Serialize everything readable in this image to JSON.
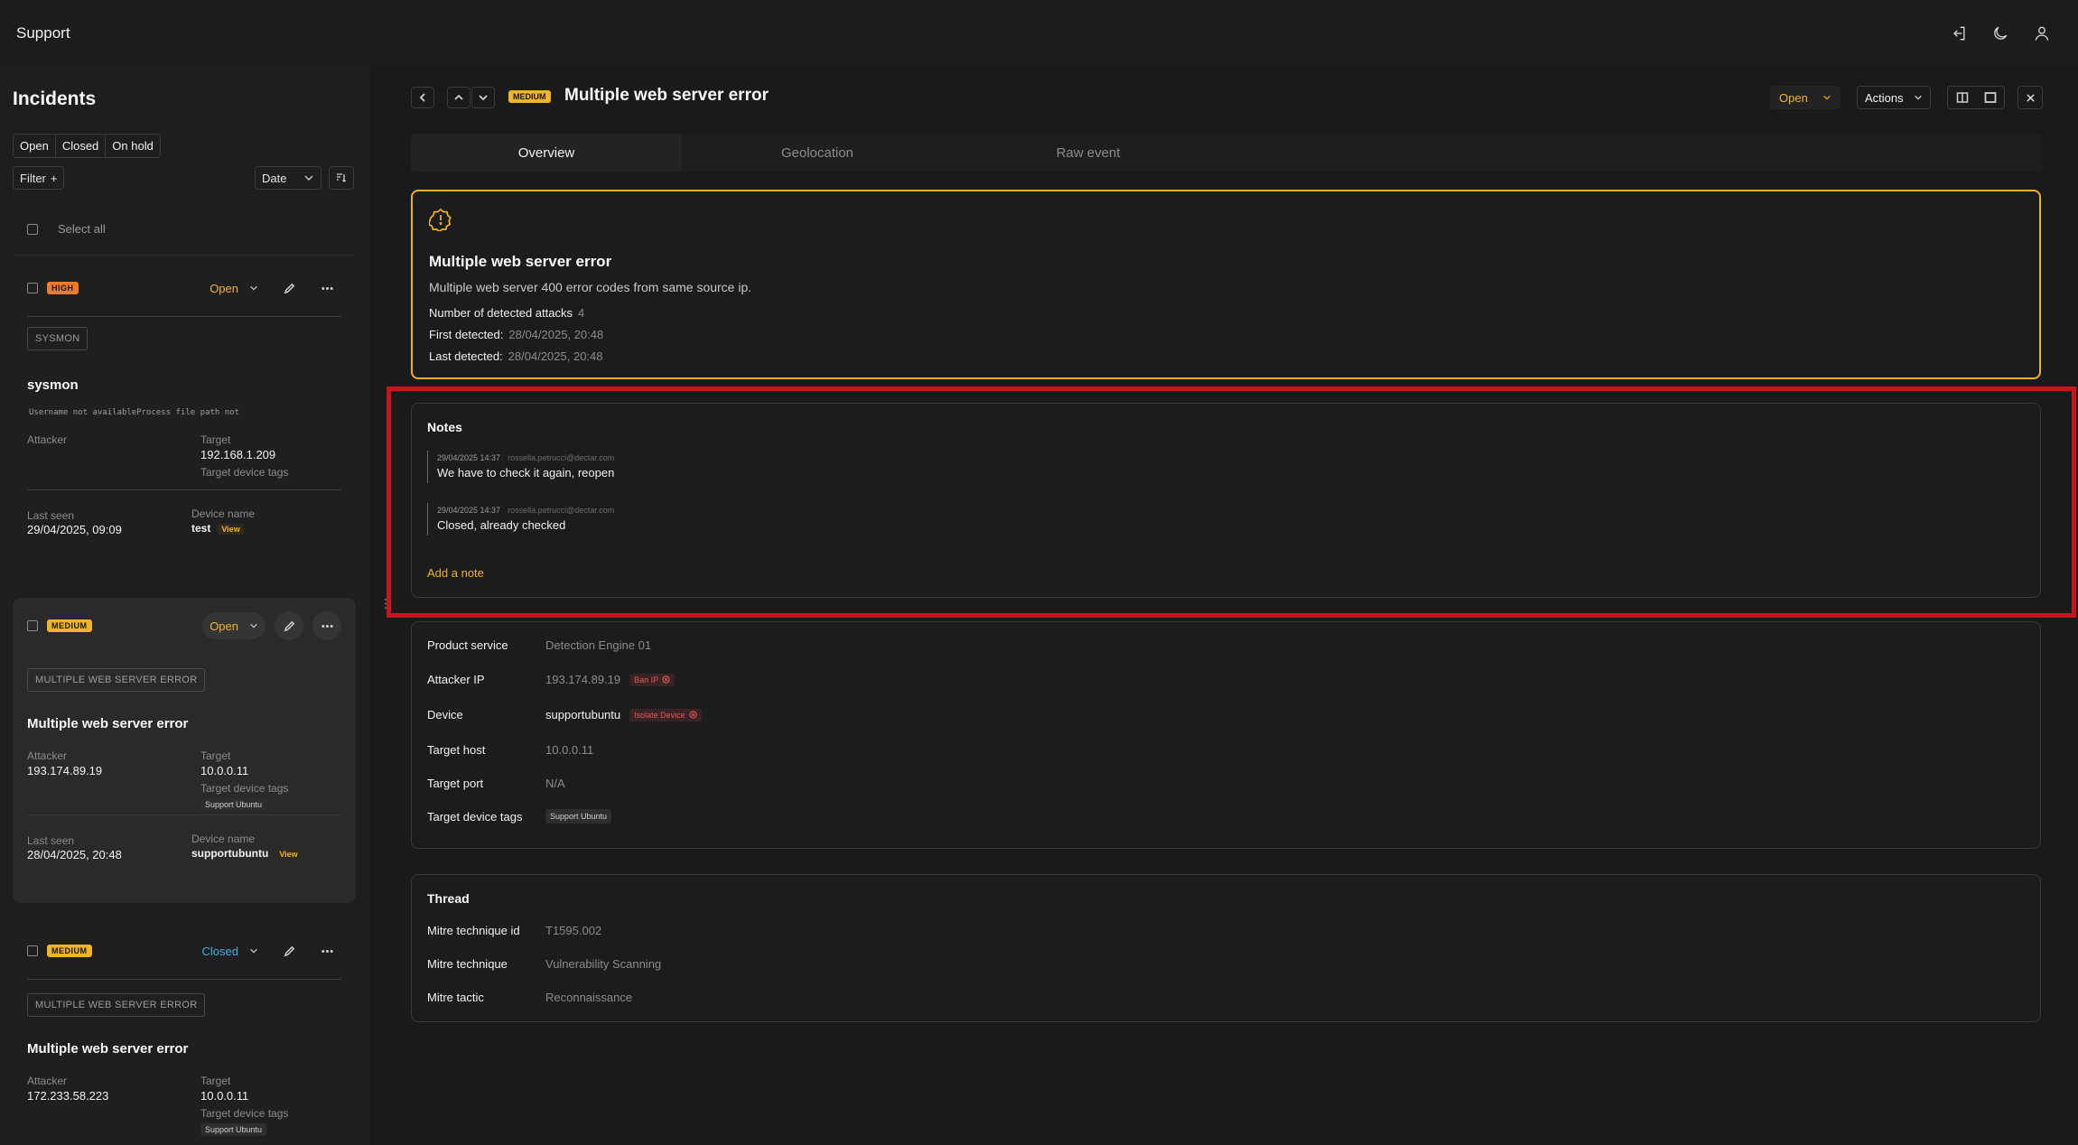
{
  "app": {
    "title": "Support"
  },
  "sidebar": {
    "title": "Incidents",
    "status_tabs": [
      "Open",
      "Closed",
      "On hold"
    ],
    "filter_label": "Filter",
    "sort_label": "Date",
    "select_all": "Select all",
    "cards": [
      {
        "severity": "HIGH",
        "status": "Open",
        "tag": "SYSMON",
        "title": "sysmon",
        "description": "Username not availableProcess file path not",
        "attacker_label": "Attacker",
        "attacker": "",
        "target_label": "Target",
        "target": "192.168.1.209",
        "tags_label": "Target device tags",
        "tags": "",
        "last_seen_label": "Last seen",
        "last_seen": "29/04/2025, 09:09",
        "device_label": "Device name",
        "device": "test",
        "view": "View"
      },
      {
        "severity": "MEDIUM",
        "status": "Open",
        "tag": "MULTIPLE WEB SERVER ERROR",
        "title": "Multiple web server error",
        "attacker_label": "Attacker",
        "attacker": "193.174.89.19",
        "target_label": "Target",
        "target": "10.0.0.11",
        "tags_label": "Target device tags",
        "tags": "Support Ubuntu",
        "last_seen_label": "Last seen",
        "last_seen": "28/04/2025, 20:48",
        "device_label": "Device name",
        "device": "supportubuntu",
        "view": "View"
      },
      {
        "severity": "MEDIUM",
        "status": "Closed",
        "tag": "MULTIPLE WEB SERVER ERROR",
        "title": "Multiple web server error",
        "attacker_label": "Attacker",
        "attacker": "172.233.58.223",
        "target_label": "Target",
        "target": "10.0.0.11",
        "tags_label": "Target device tags",
        "tags": "Support Ubuntu"
      }
    ]
  },
  "detail": {
    "severity": "MEDIUM",
    "title": "Multiple web server error",
    "status": "Open",
    "actions_label": "Actions",
    "tabs": [
      "Overview",
      "Geolocation",
      "Raw event"
    ],
    "alert": {
      "title": "Multiple web server error",
      "description": "Multiple web server 400 error codes from same source ip.",
      "attacks_label": "Number of detected attacks",
      "attacks": "4",
      "first_label": "First detected:",
      "first": "28/04/2025, 20:48",
      "last_label": "Last detected:",
      "last": "28/04/2025, 20:48"
    },
    "notes": {
      "title": "Notes",
      "items": [
        {
          "time": "29/04/2025 14:37",
          "email": "rossella.petrucci@dectar.com",
          "text": "We have to check it again, reopen"
        },
        {
          "time": "29/04/2025 14:37",
          "email": "rossella.petrucci@dectar.com",
          "text": "Closed, already checked"
        }
      ],
      "add_label": "Add a note"
    },
    "info": {
      "product_label": "Product service",
      "product": "Detection Engine 01",
      "attacker_label": "Attacker IP",
      "attacker": "193.174.89.19",
      "ban_label": "Ban IP",
      "device_label": "Device",
      "device": "supportubuntu",
      "isolate_label": "Isolate Device",
      "host_label": "Target host",
      "host": "10.0.0.11",
      "port_label": "Target port",
      "port": "N/A",
      "tags_label": "Target device tags",
      "tags": "Support Ubuntu"
    },
    "thread": {
      "title": "Thread",
      "id_label": "Mitre technique id",
      "id": "T1595.002",
      "technique_label": "Mitre technique",
      "technique": "Vulnerability Scanning",
      "tactic_label": "Mitre tactic",
      "tactic": "Reconnaissance"
    }
  },
  "colors": {
    "accent": "#f0b429",
    "high": "#f07a2c",
    "closed": "#3ab0e0",
    "highlight": "#c8151b"
  }
}
